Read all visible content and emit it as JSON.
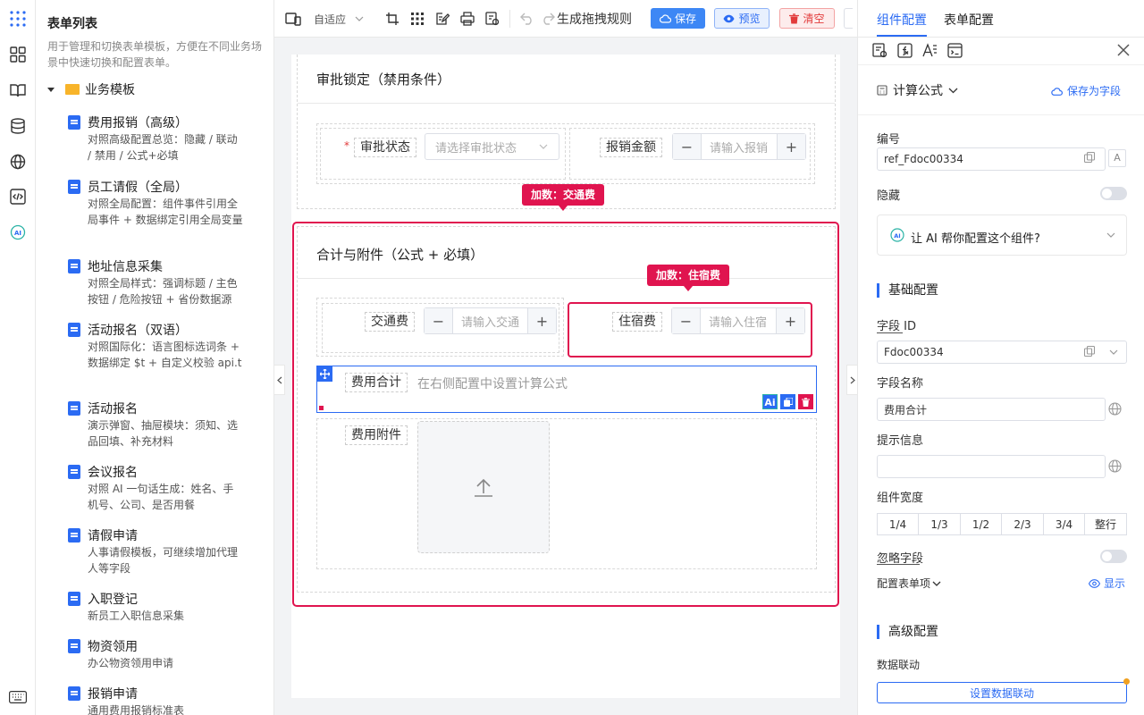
{
  "list": {
    "title": "表单列表",
    "desc": "用于管理和切换表单模板，方便在不同业务场景中快速切换和配置表单。",
    "folder": "业务模板",
    "items": [
      {
        "name": "费用报销（高级）",
        "desc": "对照高级配置总览：隐藏 / 联动 / 禁用 / 公式+必填"
      },
      {
        "name": "员工请假（全局）",
        "desc": "对照全局配置：组件事件引用全局事件 + 数据绑定引用全局变量"
      },
      {
        "name": "地址信息采集",
        "desc": "对照全局样式：强调标题 / 主色按钮 / 危险按钮 + 省份数据源"
      },
      {
        "name": "活动报名（双语）",
        "desc": "对照国际化：语言图标选词条 + 数据绑定 $t + 自定义校验 api.t"
      },
      {
        "name": "活动报名",
        "desc": "演示弹窗、抽屉模块：须知、选品回填、补充材料"
      },
      {
        "name": "会议报名",
        "desc": "对照 AI 一句话生成：姓名、手机号、公司、是否用餐"
      },
      {
        "name": "请假申请",
        "desc": "人事请假模板，可继续增加代理人等字段"
      },
      {
        "name": "入职登记",
        "desc": "新员工入职信息采集"
      },
      {
        "name": "物资领用",
        "desc": "办公物资领用申请"
      },
      {
        "name": "报销申请",
        "desc": "通用费用报销标准表"
      }
    ]
  },
  "toolbar": {
    "adaptive": "自适应",
    "rule": "生成拖拽规则",
    "save": "保存",
    "preview": "预览",
    "clear": "清空"
  },
  "canvas": {
    "sec1_title": "审批锁定（禁用条件）",
    "sec1_required": "*",
    "status_label": "审批状态",
    "status_placeholder": "请选择审批状态",
    "amount_label": "报销金额",
    "amount_placeholder": "请输入报销",
    "tag1": "加数：交通费",
    "sec2_title": "合计与附件（公式 + 必填）",
    "tag2": "加数：住宿费",
    "traffic_label": "交通费",
    "traffic_placeholder": "请输入交通",
    "hotel_label": "住宿费",
    "hotel_placeholder": "请输入住宿",
    "total_label": "费用合计",
    "total_hint": "在右侧配置中设置计算公式",
    "attach_label": "费用附件",
    "ai_badge": "Ai",
    "minus": "−",
    "plus": "+"
  },
  "panel": {
    "tab_component": "组件配置",
    "tab_form": "表单配置",
    "formula": "计算公式",
    "save_as_field": "保存为字段",
    "number_label": "编号",
    "number_value": "ref_Fdoc00334",
    "hidden_label": "隐藏",
    "ai_help": "让 AI 帮你配置这个组件?",
    "basic_title": "基础配置",
    "field_id_label": "字段 ID",
    "field_id_value": "Fdoc00334",
    "field_name_label": "字段名称",
    "field_name_value": "费用合计",
    "hint_label": "提示信息",
    "width_label": "组件宽度",
    "widths": [
      "1/4",
      "1/3",
      "1/2",
      "2/3",
      "3/4",
      "整行"
    ],
    "ignore_label": "忽略字段",
    "config_items_label": "配置表单项",
    "show_label": "显示",
    "advanced_title": "高级配置",
    "linkage_label": "数据联动",
    "linkage_button": "设置数据联动"
  },
  "colors": {
    "primary": "#2b6bf3",
    "danger": "#e0144f"
  }
}
